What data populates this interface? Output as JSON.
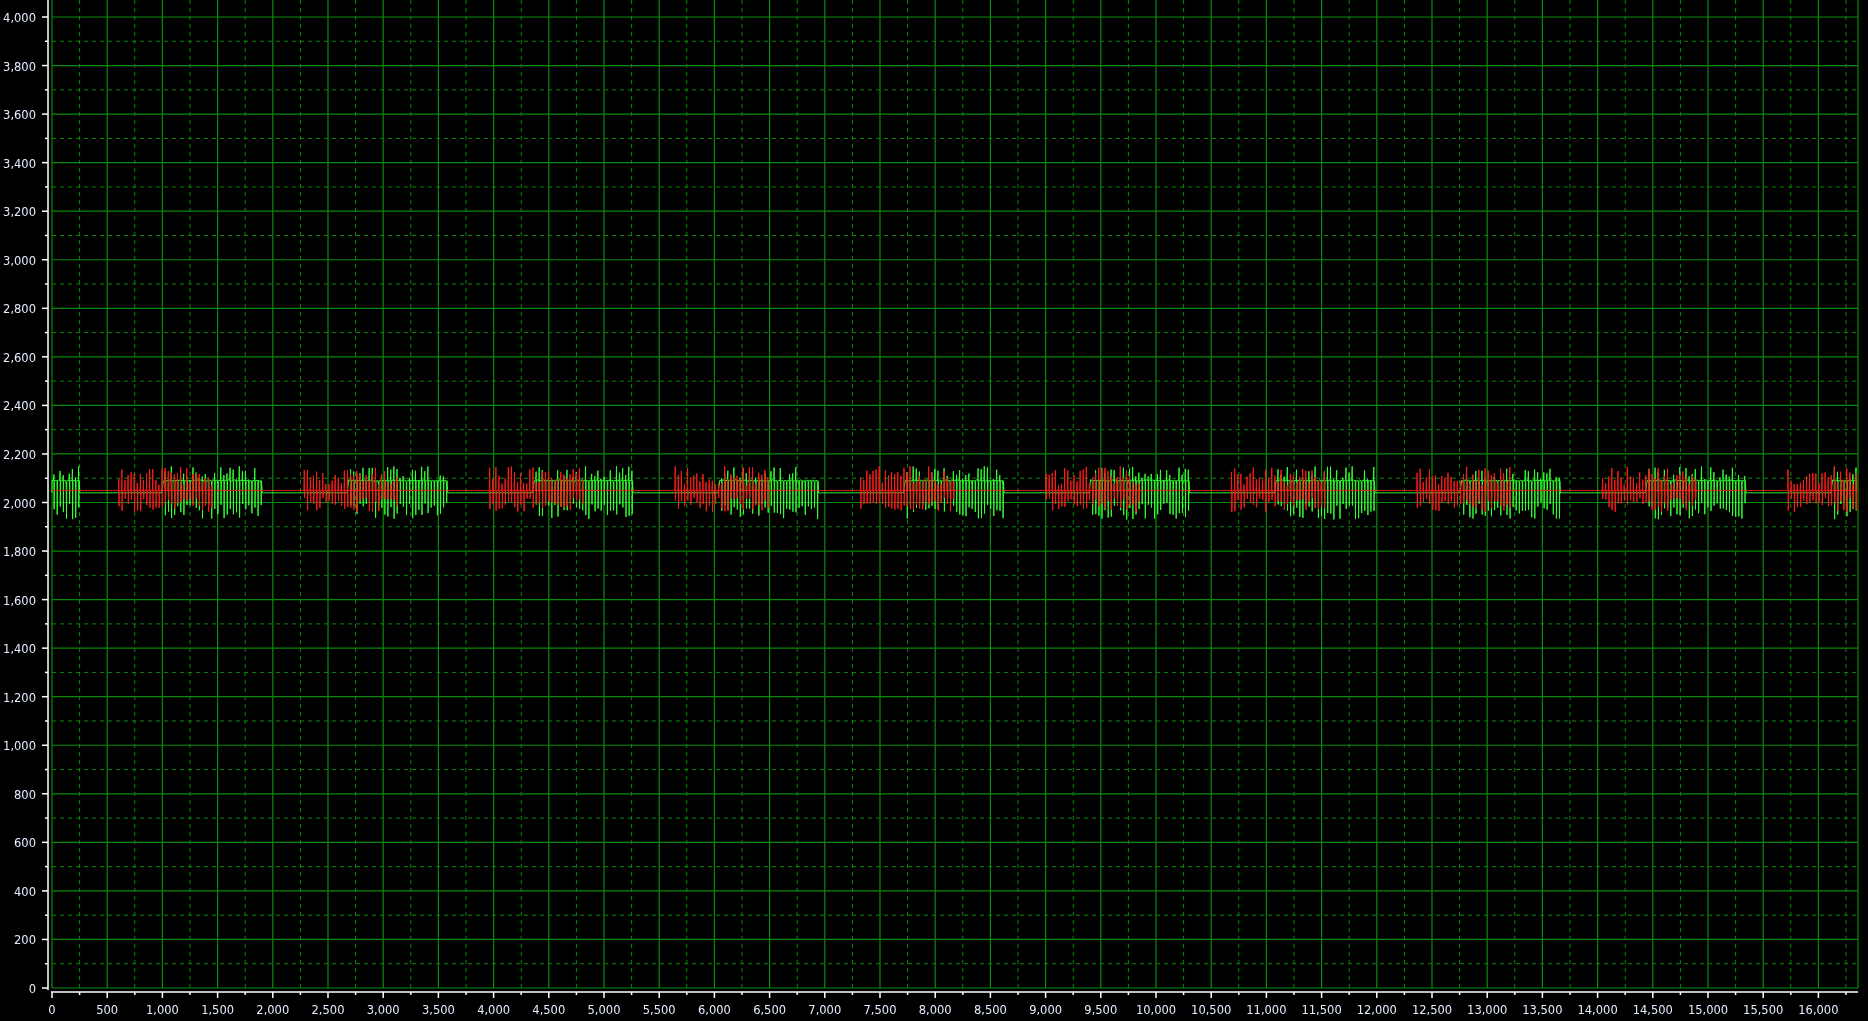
{
  "y_axis": {
    "ticks": [
      "4,000",
      "3,800",
      "3,600",
      "3,400",
      "3,200",
      "3,000",
      "2,800",
      "2,600",
      "2,400",
      "2,200",
      "2,000",
      "1,800",
      "1,600",
      "1,400",
      "1,200",
      "1,000",
      "800",
      "600",
      "400",
      "200",
      "0"
    ]
  },
  "x_axis": {
    "ticks": [
      "0",
      "500",
      "1,000",
      "1,500",
      "2,000",
      "2,500",
      "3,000",
      "3,500",
      "4,000",
      "4,500",
      "5,000",
      "5,500",
      "6,000",
      "6,500",
      "7,000",
      "7,500",
      "8,000",
      "8,500",
      "9,000",
      "9,500",
      "10,000",
      "10,500",
      "11,000",
      "11,500",
      "12,000",
      "12,500",
      "13,000",
      "13,500",
      "14,000",
      "14,500",
      "15,000",
      "15,500",
      "16,000"
    ]
  }
}
